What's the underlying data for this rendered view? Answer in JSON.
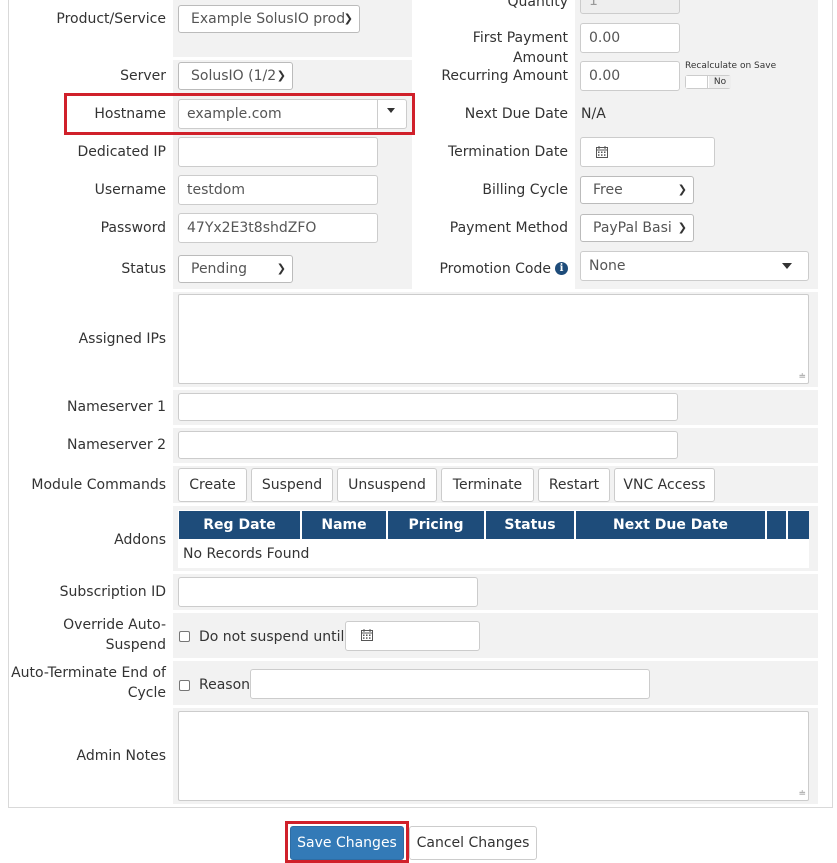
{
  "left_fields": {
    "product_service": {
      "label": "Product/Service",
      "value": "Example SolusIO prod"
    },
    "server": {
      "label": "Server",
      "value": "SolusIO (1/2"
    },
    "hostname": {
      "label": "Hostname",
      "value": "example.com"
    },
    "dedicated_ip": {
      "label": "Dedicated IP",
      "value": ""
    },
    "username": {
      "label": "Username",
      "value": "testdom"
    },
    "password": {
      "label": "Password",
      "value": "47Yx2E3t8shdZFO"
    },
    "status": {
      "label": "Status",
      "value": "Pending"
    }
  },
  "right_fields": {
    "quantity": {
      "label": "Quantity",
      "value": "1"
    },
    "first_payment": {
      "label": "First Payment Amount",
      "value": "0.00"
    },
    "recurring": {
      "label": "Recurring Amount",
      "value": "0.00",
      "recalc_label": "Recalculate on Save",
      "recalc_toggle": "No"
    },
    "next_due": {
      "label": "Next Due Date",
      "value": "N/A"
    },
    "termination": {
      "label": "Termination Date",
      "value": ""
    },
    "billing_cycle": {
      "label": "Billing Cycle",
      "value": "Free"
    },
    "payment_method": {
      "label": "Payment Method",
      "value": "PayPal Basi"
    },
    "promotion_code": {
      "label": "Promotion Code",
      "value": "None"
    }
  },
  "assigned_ips": {
    "label": "Assigned IPs",
    "value": ""
  },
  "nameserver1": {
    "label": "Nameserver 1",
    "value": ""
  },
  "nameserver2": {
    "label": "Nameserver 2",
    "value": ""
  },
  "module_commands": {
    "label": "Module Commands",
    "buttons": [
      "Create",
      "Suspend",
      "Unsuspend",
      "Terminate",
      "Restart",
      "VNC Access"
    ]
  },
  "addons": {
    "label": "Addons",
    "columns": [
      "Reg Date",
      "Name",
      "Pricing",
      "Status",
      "Next Due Date",
      "",
      ""
    ],
    "empty_text": "No Records Found"
  },
  "subscription_id": {
    "label": "Subscription ID",
    "value": ""
  },
  "override_suspend": {
    "label_line1": "Override Auto-",
    "label_line2": "Suspend",
    "checkbox_label": "Do not suspend until"
  },
  "auto_terminate": {
    "label_line1": "Auto-Terminate End of",
    "label_line2": "Cycle",
    "checkbox_label": "Reason"
  },
  "admin_notes": {
    "label": "Admin Notes",
    "value": ""
  },
  "actions": {
    "save": "Save Changes",
    "cancel": "Cancel Changes"
  },
  "colors": {
    "accent": "#337ab7",
    "table_header": "#1e4c7a",
    "highlight": "#d0202a",
    "field_bg": "#f2f2f2"
  }
}
